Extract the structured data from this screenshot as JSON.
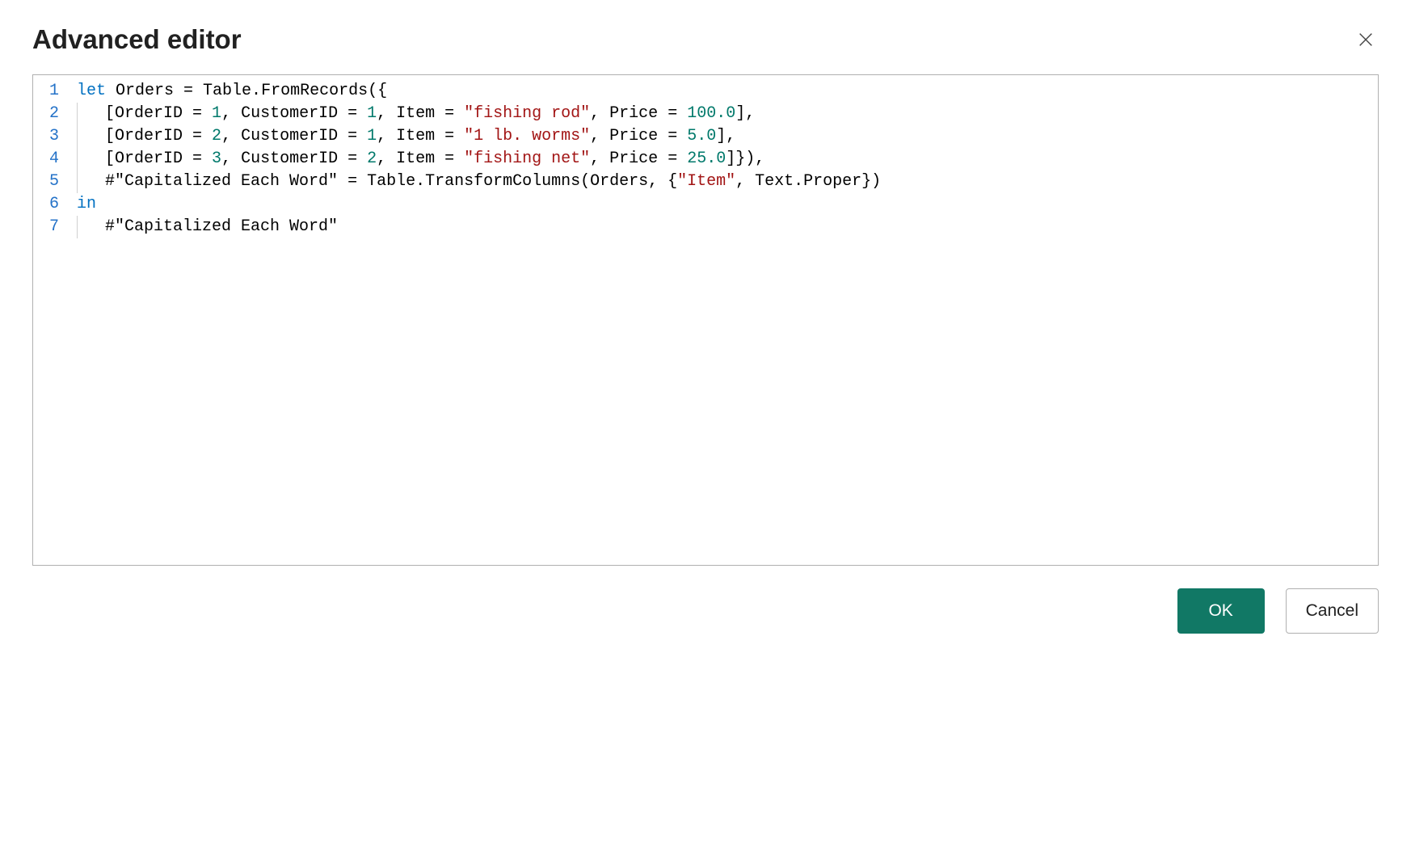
{
  "header": {
    "title": "Advanced editor"
  },
  "code": {
    "lines": [
      {
        "indent": 0,
        "tokens": [
          {
            "t": "let",
            "c": "tok-keyword"
          },
          {
            "t": " Orders = Table.FromRecords({",
            "c": "tok-ident"
          }
        ]
      },
      {
        "indent": 1,
        "tokens": [
          {
            "t": "[OrderID = ",
            "c": "tok-ident"
          },
          {
            "t": "1",
            "c": "tok-number"
          },
          {
            "t": ", CustomerID = ",
            "c": "tok-ident"
          },
          {
            "t": "1",
            "c": "tok-number"
          },
          {
            "t": ", Item = ",
            "c": "tok-ident"
          },
          {
            "t": "\"fishing rod\"",
            "c": "tok-string"
          },
          {
            "t": ", Price = ",
            "c": "tok-ident"
          },
          {
            "t": "100.0",
            "c": "tok-number"
          },
          {
            "t": "],",
            "c": "tok-ident"
          }
        ]
      },
      {
        "indent": 1,
        "tokens": [
          {
            "t": "[OrderID = ",
            "c": "tok-ident"
          },
          {
            "t": "2",
            "c": "tok-number"
          },
          {
            "t": ", CustomerID = ",
            "c": "tok-ident"
          },
          {
            "t": "1",
            "c": "tok-number"
          },
          {
            "t": ", Item = ",
            "c": "tok-ident"
          },
          {
            "t": "\"1 lb. worms\"",
            "c": "tok-string"
          },
          {
            "t": ", Price = ",
            "c": "tok-ident"
          },
          {
            "t": "5.0",
            "c": "tok-number"
          },
          {
            "t": "],",
            "c": "tok-ident"
          }
        ]
      },
      {
        "indent": 1,
        "tokens": [
          {
            "t": "[OrderID = ",
            "c": "tok-ident"
          },
          {
            "t": "3",
            "c": "tok-number"
          },
          {
            "t": ", CustomerID = ",
            "c": "tok-ident"
          },
          {
            "t": "2",
            "c": "tok-number"
          },
          {
            "t": ", Item = ",
            "c": "tok-ident"
          },
          {
            "t": "\"fishing net\"",
            "c": "tok-string"
          },
          {
            "t": ", Price = ",
            "c": "tok-ident"
          },
          {
            "t": "25.0",
            "c": "tok-number"
          },
          {
            "t": "]}),",
            "c": "tok-ident"
          }
        ]
      },
      {
        "indent": 1,
        "tokens": [
          {
            "t": "#\"Capitalized Each Word\"",
            "c": "tok-ident"
          },
          {
            "t": " = Table.TransformColumns(Orders, {",
            "c": "tok-ident"
          },
          {
            "t": "\"Item\"",
            "c": "tok-string"
          },
          {
            "t": ", Text.Proper})",
            "c": "tok-ident"
          }
        ]
      },
      {
        "indent": 0,
        "tokens": [
          {
            "t": "in",
            "c": "tok-keyword"
          }
        ]
      },
      {
        "indent": 1,
        "tokens": [
          {
            "t": "#\"Capitalized Each Word\"",
            "c": "tok-ident"
          }
        ]
      }
    ]
  },
  "footer": {
    "ok_label": "OK",
    "cancel_label": "Cancel"
  }
}
